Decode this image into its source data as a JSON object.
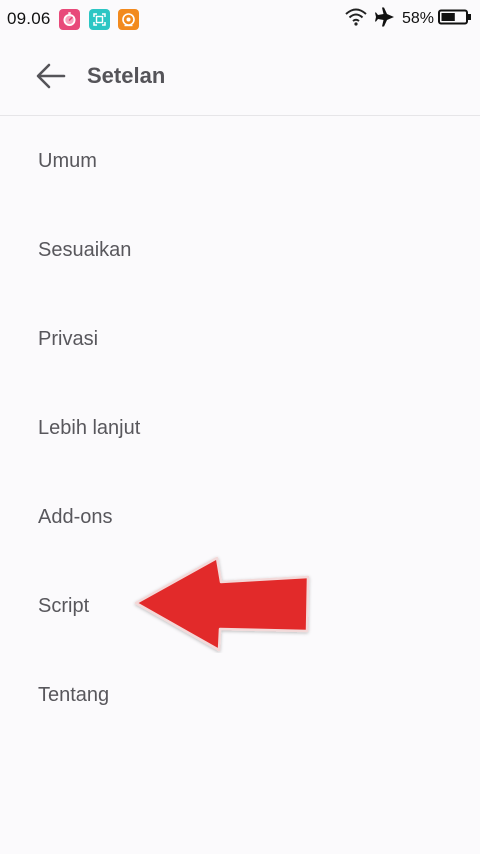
{
  "status_bar": {
    "time": "09.06",
    "battery_percent": "58%",
    "battery_level": 0.58,
    "notification_icons": [
      "timer-app-icon",
      "screenshot-app-icon",
      "camera-app-icon"
    ],
    "status_icons": [
      "wifi-icon",
      "airplane-mode-icon",
      "battery-icon"
    ]
  },
  "header": {
    "back_icon": "arrow-left-icon",
    "title": "Setelan"
  },
  "menu": {
    "items": [
      {
        "label": "Umum"
      },
      {
        "label": "Sesuaikan"
      },
      {
        "label": "Privasi"
      },
      {
        "label": "Lebih lanjut"
      },
      {
        "label": "Add-ons"
      },
      {
        "label": "Script"
      },
      {
        "label": "Tentang"
      }
    ]
  },
  "annotation": {
    "type": "arrow",
    "points_to": "Script",
    "color": "#e22a2a"
  },
  "colors": {
    "background": "#fbfafc",
    "text": "#58575c",
    "title": "#555459",
    "divider": "#e6e5e8"
  }
}
